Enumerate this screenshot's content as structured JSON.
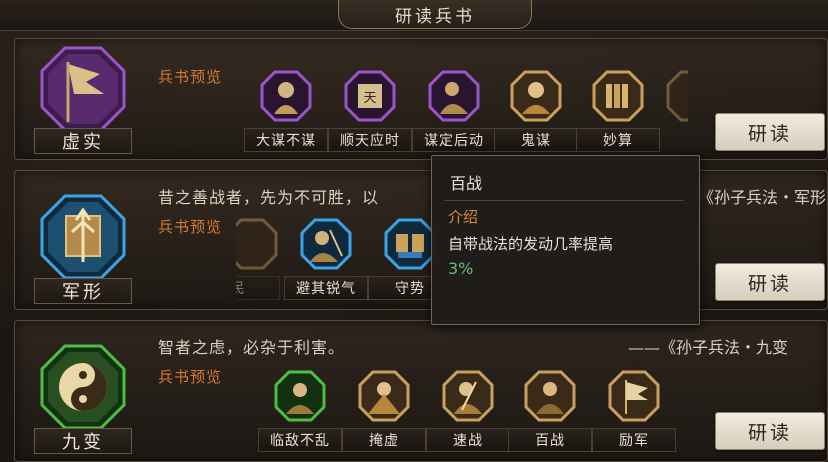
{
  "window": {
    "title": "研读兵书"
  },
  "colors": {
    "purple": "#8a3fb5",
    "blue": "#2b8fd3",
    "green": "#3a9a3a",
    "gold": "#c9a060",
    "orange": "#d47a33",
    "green_value": "#5fc079"
  },
  "books": [
    {
      "name": "虚实",
      "preview_label": "兵书预览",
      "study_label": "研读",
      "emblem_icon": "banner-flag-icon",
      "skills": [
        {
          "name": "大谋不谋",
          "icon": "strategist-portrait-icon",
          "frame": "purple"
        },
        {
          "name": "顺天应时",
          "icon": "scroll-tian-icon",
          "frame": "purple"
        },
        {
          "name": "谋定后动",
          "icon": "thinker-portrait-icon",
          "frame": "purple"
        },
        {
          "name": "鬼谋",
          "icon": "scholar-portrait-icon",
          "frame": "gold"
        },
        {
          "name": "妙算",
          "icon": "bamboo-scroll-icon",
          "frame": "gold"
        }
      ]
    },
    {
      "name": "军形",
      "quote": "昔之善战者，先为不可胜，以",
      "source": "孙子兵法・军形",
      "preview_label": "兵书预览",
      "study_label": "研读",
      "emblem_icon": "arrow-shield-icon",
      "skills": [
        {
          "name": "民",
          "icon": "partial-skill-icon",
          "frame": "gold"
        },
        {
          "name": "避其锐气",
          "icon": "archer-portrait-icon",
          "frame": "blue"
        },
        {
          "name": "守势",
          "icon": "shield-pair-icon",
          "frame": "blue"
        }
      ]
    },
    {
      "name": "九变",
      "quote": "智者之虑，必杂于利害。",
      "source": "——《孙子兵法・九变",
      "preview_label": "兵书预览",
      "study_label": "研读",
      "emblem_icon": "yin-yang-icon",
      "skills": [
        {
          "name": "临敌不乱",
          "icon": "calm-general-icon",
          "frame": "green"
        },
        {
          "name": "掩虚",
          "icon": "cloaked-soldier-icon",
          "frame": "gold"
        },
        {
          "name": "速战",
          "icon": "swift-soldier-icon",
          "frame": "gold"
        },
        {
          "name": "百战",
          "icon": "veteran-soldier-icon",
          "frame": "gold"
        },
        {
          "name": "励军",
          "icon": "rally-banner-icon",
          "frame": "gold"
        }
      ]
    }
  ],
  "tooltip": {
    "title": "百战",
    "intro_label": "介绍",
    "description": "自带战法的发动几率提高",
    "value": "3%"
  }
}
